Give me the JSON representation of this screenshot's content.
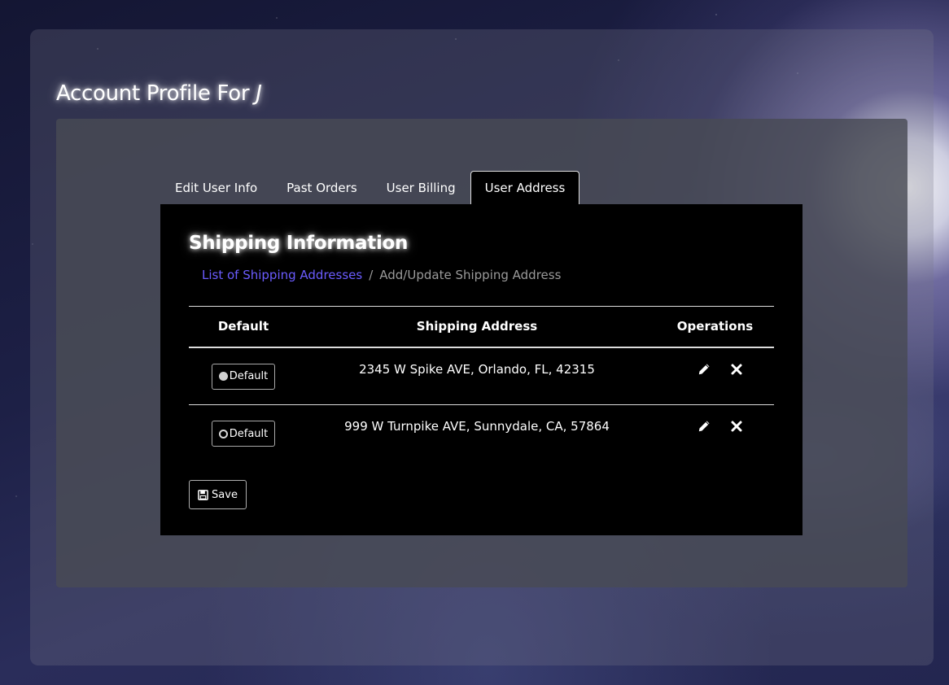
{
  "header": {
    "title_prefix": "Account Profile For ",
    "user_name": "J"
  },
  "tabs": [
    {
      "label": "Edit User Info",
      "active": false
    },
    {
      "label": "Past Orders",
      "active": false
    },
    {
      "label": "User Billing",
      "active": false
    },
    {
      "label": "User Address",
      "active": true
    }
  ],
  "shipping": {
    "title": "Shipping Information",
    "breadcrumb": {
      "link": "List of Shipping Addresses",
      "separator": "/",
      "current": "Add/Update Shipping Address"
    },
    "columns": [
      "Default",
      "Shipping Address",
      "Operations"
    ],
    "rows": [
      {
        "default_label": "Default",
        "selected": true,
        "address": "2345 W Spike AVE, Orlando, FL, 42315"
      },
      {
        "default_label": "Default",
        "selected": false,
        "address": "999 W Turnpike AVE, Sunnydale, CA, 57864"
      }
    ],
    "save_label": "Save"
  },
  "colors": {
    "link": "#6b5cff",
    "panel": "#484a54",
    "content_bg": "#000000"
  },
  "icons": {
    "edit": "pencil-icon",
    "delete": "times-icon",
    "save": "floppy-disk-icon"
  }
}
